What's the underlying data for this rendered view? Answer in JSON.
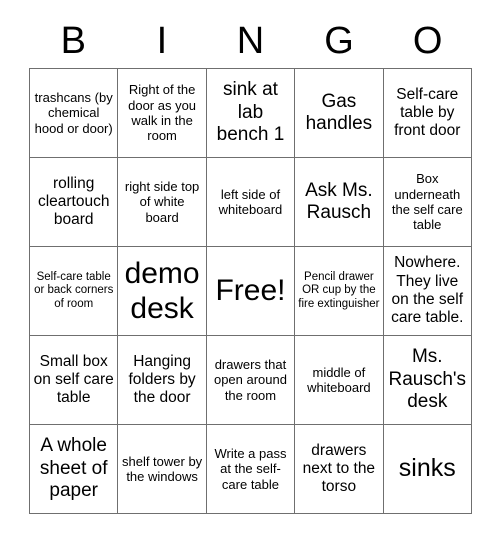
{
  "card": {
    "header": [
      "B",
      "I",
      "N",
      "G",
      "O"
    ],
    "rows": [
      [
        {
          "text": "trashcans (by chemical hood or door)",
          "size": "s-sm"
        },
        {
          "text": "Right of the door as you walk in the room",
          "size": "s-sm"
        },
        {
          "text": "sink at lab bench 1",
          "size": "s-lg"
        },
        {
          "text": "Gas handles",
          "size": "s-lg"
        },
        {
          "text": "Self-care table by front door",
          "size": "s-md"
        }
      ],
      [
        {
          "text": "rolling cleartouch board",
          "size": "s-md"
        },
        {
          "text": "right side top of white board",
          "size": "s-sm"
        },
        {
          "text": "left side of whiteboard",
          "size": "s-sm"
        },
        {
          "text": "Ask Ms. Rausch",
          "size": "s-lg"
        },
        {
          "text": "Box underneath the self care table",
          "size": "s-sm"
        }
      ],
      [
        {
          "text": "Self-care table or back corners of room",
          "size": "s-xs"
        },
        {
          "text": "demo desk",
          "size": "s-xxl"
        },
        {
          "text": "Free!",
          "size": "s-xxl"
        },
        {
          "text": "Pencil drawer OR cup by the fire extinguisher",
          "size": "s-xs"
        },
        {
          "text": "Nowhere. They live on the self care table.",
          "size": "s-md"
        }
      ],
      [
        {
          "text": "Small box on self care table",
          "size": "s-md"
        },
        {
          "text": "Hanging folders by the door",
          "size": "s-md"
        },
        {
          "text": "drawers that open around the room",
          "size": "s-sm"
        },
        {
          "text": "middle of whiteboard",
          "size": "s-sm"
        },
        {
          "text": "Ms. Rausch's desk",
          "size": "s-lg"
        }
      ],
      [
        {
          "text": "A whole sheet of paper",
          "size": "s-lg"
        },
        {
          "text": "shelf tower by the windows",
          "size": "s-sm"
        },
        {
          "text": "Write a pass at the self-care table",
          "size": "s-sm"
        },
        {
          "text": "drawers next to the torso",
          "size": "s-md"
        },
        {
          "text": "sinks",
          "size": "s-xl"
        }
      ]
    ]
  }
}
